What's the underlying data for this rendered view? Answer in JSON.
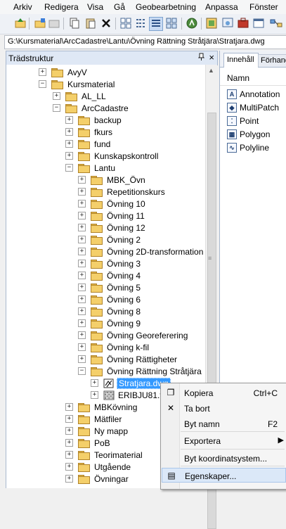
{
  "menubar": [
    "Arkiv",
    "Redigera",
    "Visa",
    "Gå",
    "Geobearbetning",
    "Anpassa",
    "Fönster"
  ],
  "path": "G:\\Kursmaterial\\ArcCadastre\\Lantu\\Övning Rättning Stråtjära\\Stratjara.dwg",
  "tree_panel": {
    "title": "Trädstruktur",
    "pin": "ᵖ",
    "close": "×"
  },
  "tree": [
    {
      "label": "AvyV",
      "level": 1,
      "expander": "+",
      "icon": "folder"
    },
    {
      "label": "Kursmaterial",
      "level": 1,
      "expander": "−",
      "icon": "folder"
    },
    {
      "label": "AL_LL",
      "level": 2,
      "expander": "+",
      "icon": "folder"
    },
    {
      "label": "ArcCadastre",
      "level": 2,
      "expander": "−",
      "icon": "folder"
    },
    {
      "label": "backup",
      "level": 3,
      "expander": "+",
      "icon": "folder"
    },
    {
      "label": "fkurs",
      "level": 3,
      "expander": "+",
      "icon": "folder"
    },
    {
      "label": "fund",
      "level": 3,
      "expander": "+",
      "icon": "folder"
    },
    {
      "label": "Kunskapskontroll",
      "level": 3,
      "expander": "+",
      "icon": "folder"
    },
    {
      "label": "Lantu",
      "level": 3,
      "expander": "−",
      "icon": "folder"
    },
    {
      "label": "MBK_Övn",
      "level": 4,
      "expander": "+",
      "icon": "folder"
    },
    {
      "label": "Repetitionskurs",
      "level": 4,
      "expander": "+",
      "icon": "folder"
    },
    {
      "label": "Övning 10",
      "level": 4,
      "expander": "+",
      "icon": "folder"
    },
    {
      "label": "Övning 11",
      "level": 4,
      "expander": "+",
      "icon": "folder"
    },
    {
      "label": "Övning 12",
      "level": 4,
      "expander": "+",
      "icon": "folder"
    },
    {
      "label": "Övning 2",
      "level": 4,
      "expander": "+",
      "icon": "folder"
    },
    {
      "label": "Övning 2D-transformation",
      "level": 4,
      "expander": "+",
      "icon": "folder"
    },
    {
      "label": "Övning 3",
      "level": 4,
      "expander": "+",
      "icon": "folder"
    },
    {
      "label": "Övning 4",
      "level": 4,
      "expander": "+",
      "icon": "folder"
    },
    {
      "label": "Övning 5",
      "level": 4,
      "expander": "+",
      "icon": "folder"
    },
    {
      "label": "Övning 6",
      "level": 4,
      "expander": "+",
      "icon": "folder"
    },
    {
      "label": "Övning 8",
      "level": 4,
      "expander": "+",
      "icon": "folder"
    },
    {
      "label": "Övning 9",
      "level": 4,
      "expander": "+",
      "icon": "folder"
    },
    {
      "label": "Övning Georeferering",
      "level": 4,
      "expander": "+",
      "icon": "folder"
    },
    {
      "label": "Övning k-fil",
      "level": 4,
      "expander": "+",
      "icon": "folder"
    },
    {
      "label": "Övning Rättigheter",
      "level": 4,
      "expander": "+",
      "icon": "folder"
    },
    {
      "label": "Övning Rättning Stråtjära",
      "level": 4,
      "expander": "−",
      "icon": "folder"
    },
    {
      "label": "Stratjara.dwg",
      "level": 5,
      "expander": "+",
      "icon": "cad",
      "selected": true
    },
    {
      "label": "ERIBJU81.tif",
      "level": 5,
      "expander": "+",
      "icon": "raster"
    },
    {
      "label": "MBKövning",
      "level": 3,
      "expander": "+",
      "icon": "folder"
    },
    {
      "label": "Mätfiler",
      "level": 3,
      "expander": "+",
      "icon": "folder"
    },
    {
      "label": "Ny mapp",
      "level": 3,
      "expander": "+",
      "icon": "folder"
    },
    {
      "label": "PoB",
      "level": 3,
      "expander": "+",
      "icon": "folder"
    },
    {
      "label": "Teorimaterial",
      "level": 3,
      "expander": "+",
      "icon": "folder"
    },
    {
      "label": "Utgående",
      "level": 3,
      "expander": "+",
      "icon": "folder"
    },
    {
      "label": "Övningar",
      "level": 3,
      "expander": "+",
      "icon": "folder"
    }
  ],
  "right_panel": {
    "tab_active": "Innehåll",
    "tab_other": "Förhand",
    "column": "Namn",
    "items": [
      {
        "label": "Annotation",
        "icon": "annotation-icon",
        "glyph": "A"
      },
      {
        "label": "MultiPatch",
        "icon": "multipatch-icon",
        "glyph": "◆"
      },
      {
        "label": "Point",
        "icon": "point-icon",
        "glyph": "⁚"
      },
      {
        "label": "Polygon",
        "icon": "polygon-icon",
        "glyph": "▦"
      },
      {
        "label": "Polyline",
        "icon": "polyline-icon",
        "glyph": "∿"
      }
    ]
  },
  "context_menu": {
    "items": [
      {
        "label": "Kopiera",
        "shortcut": "Ctrl+C",
        "icon": "copy-icon",
        "glyph": "❐"
      },
      {
        "label": "Ta bort",
        "shortcut": "",
        "icon": "delete-icon",
        "glyph": "✕"
      },
      {
        "label": "Byt namn",
        "shortcut": "F2",
        "icon": "",
        "glyph": ""
      },
      {
        "label": "Exportera",
        "shortcut": "",
        "icon": "",
        "glyph": "",
        "submenu": "▶"
      },
      {
        "label": "Byt koordinatsystem...",
        "shortcut": "",
        "icon": "",
        "glyph": ""
      },
      {
        "label": "Egenskaper...",
        "shortcut": "",
        "icon": "properties-icon",
        "glyph": "▤",
        "highlighted": true
      }
    ]
  },
  "colors": {
    "selection": "#3399ff",
    "folder": "#f4cf6a",
    "panel_header": "#dfe8f5",
    "menu_highlight": "#dbe8f8"
  }
}
